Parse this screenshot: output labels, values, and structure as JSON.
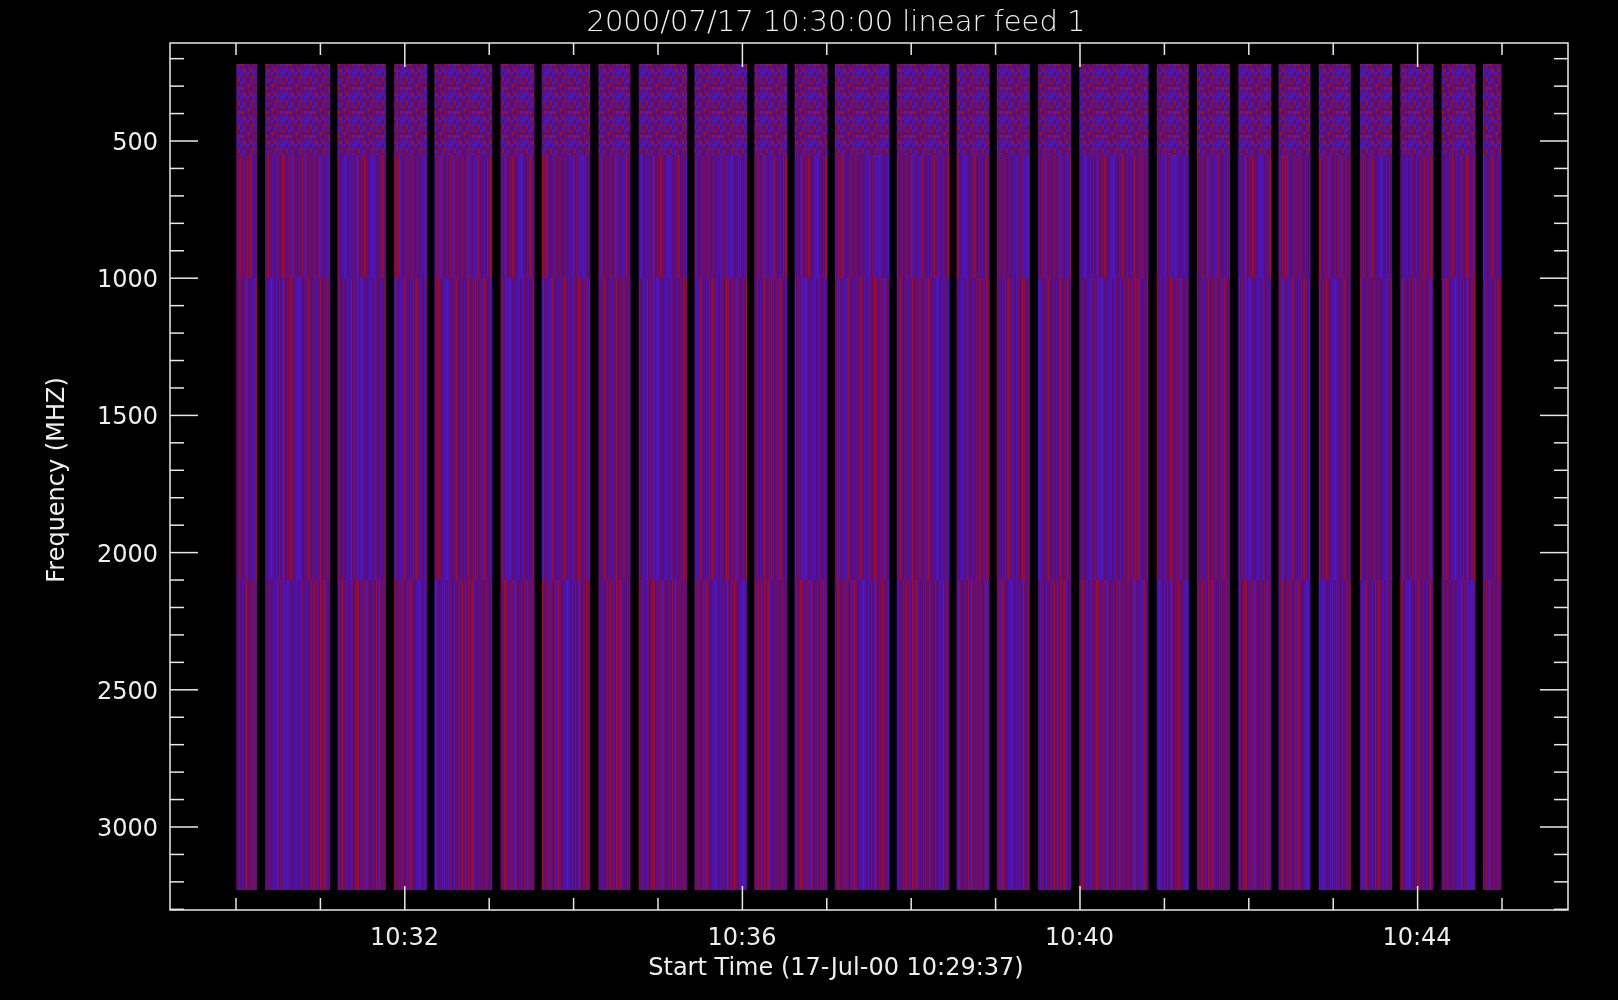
{
  "title": "2000/07/17 10:30:00 linear feed 1",
  "ylabel": "Frequency (MHZ)",
  "xlabel": "Start Time (17-Jul-00 10:29:37)",
  "yticks": [
    "500",
    "1000",
    "1500",
    "2000",
    "2500",
    "3000"
  ],
  "xticks": [
    "10:32",
    "10:36",
    "10:40",
    "10:44"
  ]
}
